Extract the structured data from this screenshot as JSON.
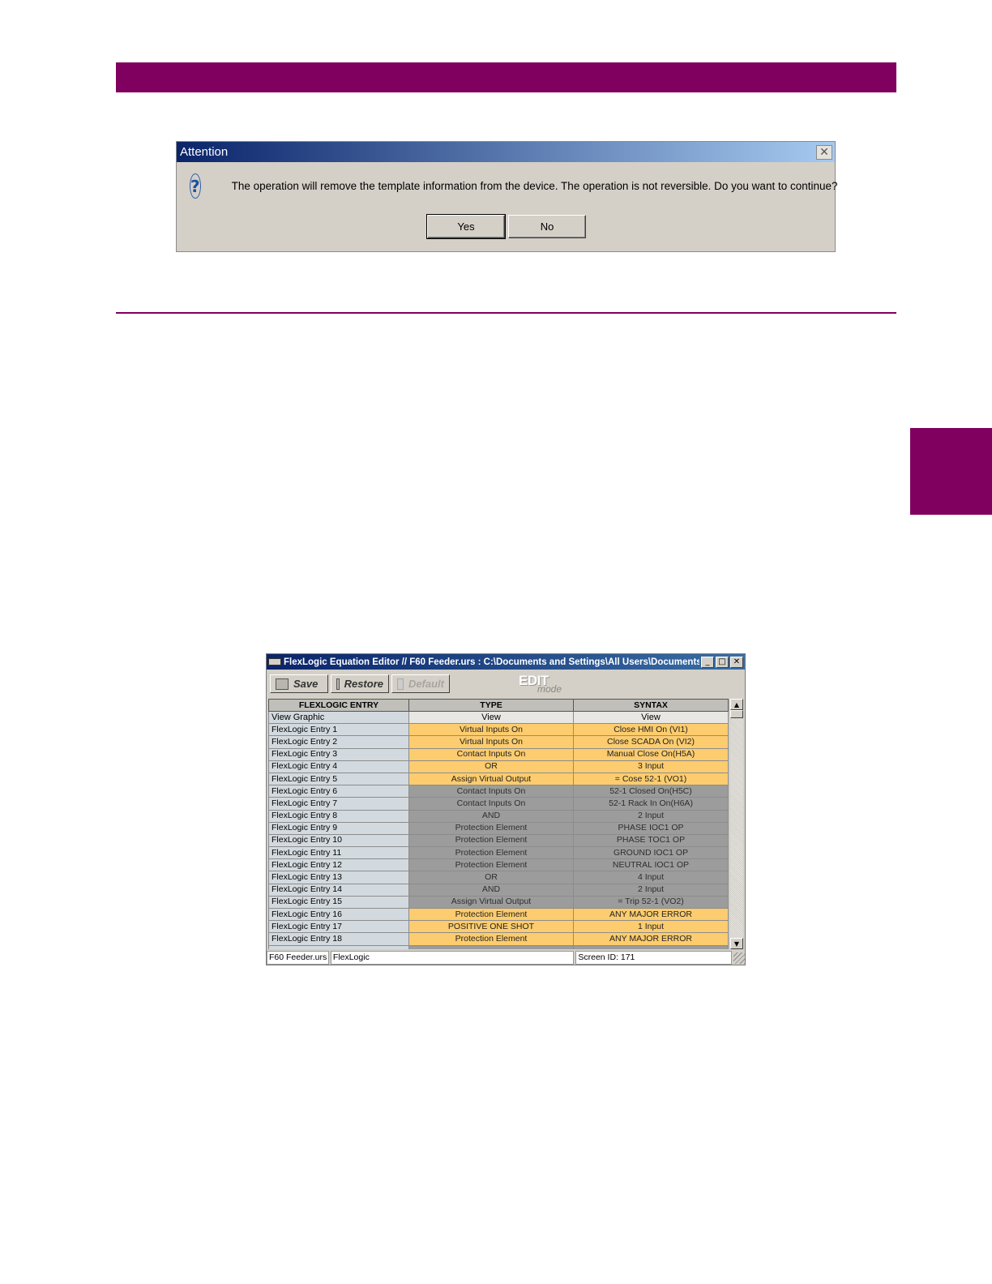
{
  "colors": {
    "brand": "#80005f",
    "dialog_title_start": "#0a246a",
    "dialog_title_end": "#a6caf0",
    "selected_cell": "#fccc6e",
    "unselected_cell": "#9c9c9c"
  },
  "attention_dialog": {
    "title": "Attention",
    "icon": "question-icon",
    "message": "The operation will remove the template information from the device. The operation is not reversible. Do you want to continue?",
    "yes_label": "Yes",
    "no_label": "No"
  },
  "flexlogic_window": {
    "title": "FlexLogic Equation Editor // F60 Feeder.urs : C:\\Documents and Settings\\All Users\\Documents\\...",
    "toolbar": {
      "save_label": "Save",
      "restore_label": "Restore",
      "default_label": "Default",
      "mode_text_1": "EDIT",
      "mode_text_2": "mode"
    },
    "headers": [
      "FLEXLOGIC ENTRY",
      "TYPE",
      "SYNTAX"
    ],
    "view_row": {
      "label": "View Graphic",
      "type": "View",
      "syntax": "View"
    },
    "rows": [
      {
        "entry": "FlexLogic Entry 1",
        "type": "Virtual Inputs On",
        "syntax": "Close HMI On (VI1)"
      },
      {
        "entry": "FlexLogic Entry 2",
        "type": "Virtual Inputs On",
        "syntax": "Close SCADA On (VI2)"
      },
      {
        "entry": "FlexLogic Entry 3",
        "type": "Contact Inputs On",
        "syntax": "Manual Close On(H5A)"
      },
      {
        "entry": "FlexLogic Entry 4",
        "type": "OR",
        "syntax": "3 Input"
      },
      {
        "entry": "FlexLogic Entry 5",
        "type": "Assign Virtual Output",
        "syntax": "= Cose 52-1 (VO1)"
      },
      {
        "entry": "FlexLogic Entry 6",
        "type": "Contact Inputs On",
        "syntax": "52-1 Closed On(H5C)"
      },
      {
        "entry": "FlexLogic Entry 7",
        "type": "Contact Inputs On",
        "syntax": "52-1 Rack In On(H6A)"
      },
      {
        "entry": "FlexLogic Entry 8",
        "type": "AND",
        "syntax": "2 Input"
      },
      {
        "entry": "FlexLogic Entry 9",
        "type": "Protection Element",
        "syntax": "PHASE IOC1 OP"
      },
      {
        "entry": "FlexLogic Entry 10",
        "type": "Protection Element",
        "syntax": "PHASE TOC1 OP"
      },
      {
        "entry": "FlexLogic Entry 11",
        "type": "Protection Element",
        "syntax": "GROUND IOC1 OP"
      },
      {
        "entry": "FlexLogic Entry 12",
        "type": "Protection Element",
        "syntax": "NEUTRAL IOC1 OP"
      },
      {
        "entry": "FlexLogic Entry 13",
        "type": "OR",
        "syntax": "4 Input"
      },
      {
        "entry": "FlexLogic Entry 14",
        "type": "AND",
        "syntax": "2 Input"
      },
      {
        "entry": "FlexLogic Entry 15",
        "type": "Assign Virtual Output",
        "syntax": "= Trip 52-1 (VO2)"
      },
      {
        "entry": "FlexLogic Entry 16",
        "type": "Protection Element",
        "syntax": "ANY MAJOR ERROR"
      },
      {
        "entry": "FlexLogic Entry 17",
        "type": "POSITIVE ONE SHOT",
        "syntax": "1 Input"
      },
      {
        "entry": "FlexLogic Entry 18",
        "type": "Protection Element",
        "syntax": "ANY MAJOR ERROR"
      }
    ],
    "selected_rows": [
      1,
      2,
      3,
      4,
      5,
      16,
      17,
      18
    ],
    "status": {
      "file": "F60 Feeder.urs",
      "section": "FlexLogic",
      "screen_id": "Screen ID: 171"
    }
  }
}
